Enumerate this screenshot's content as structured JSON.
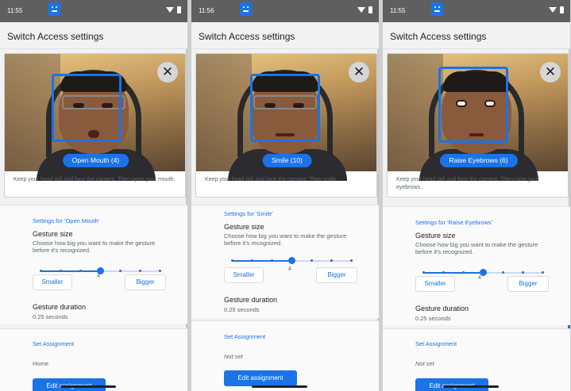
{
  "colors": {
    "accent": "#1a73e8",
    "statusbar": "#5f5f5f",
    "background": "#f2f2f2"
  },
  "panels": [
    {
      "status_time": "11:55",
      "app_title": "Switch Access settings",
      "gesture_label": "Open Mouth (4)",
      "instruction": "Keep your head still and face the camera. Then open your mouth.",
      "settings_header": "Settings for 'Open Mouth'",
      "size_title": "Gesture size",
      "size_desc": "Choose how big you want to make the gesture before it's recognized.",
      "size_value": "4",
      "size_level": 4,
      "size_max": 7,
      "smaller": "Smaller",
      "bigger": "Bigger",
      "duration_title": "Gesture duration",
      "duration_value": "0.25 seconds",
      "assign_header": "Set Assignment",
      "assign_value": "Home",
      "edit": "Edit assignment"
    },
    {
      "status_time": "11:56",
      "app_title": "Switch Access settings",
      "gesture_label": "Smile (10)",
      "instruction": "Keep your head still and face the camera. Then smile.",
      "settings_header": "Settings for 'Smile'",
      "size_title": "Gesture size",
      "size_desc": "Choose how big you want to make the gesture before it's recognized.",
      "size_value": "4",
      "size_level": 4,
      "size_max": 7,
      "smaller": "Smaller",
      "bigger": "Bigger",
      "duration_title": "Gesture duration",
      "duration_value": "0.25 seconds",
      "assign_header": "Set Assignment",
      "assign_value": "Not set",
      "edit": "Edit assignment"
    },
    {
      "status_time": "11:55",
      "app_title": "Switch Access settings",
      "gesture_label": "Raise Eyebrows (6)",
      "instruction": "Keep your head still and face the camera. Then raise your eyebrows.",
      "settings_header": "Settings for 'Raise Eyebrows'",
      "size_title": "Gesture size",
      "size_desc": "Choose how big you want to make the gesture before it's recognized.",
      "size_value": "4",
      "size_level": 4,
      "size_max": 7,
      "smaller": "Smaller",
      "bigger": "Bigger",
      "duration_title": "Gesture duration",
      "duration_value": "0.25 seconds",
      "assign_header": "Set Assignment",
      "assign_value": "Not set",
      "edit": "Edit assignment"
    }
  ]
}
